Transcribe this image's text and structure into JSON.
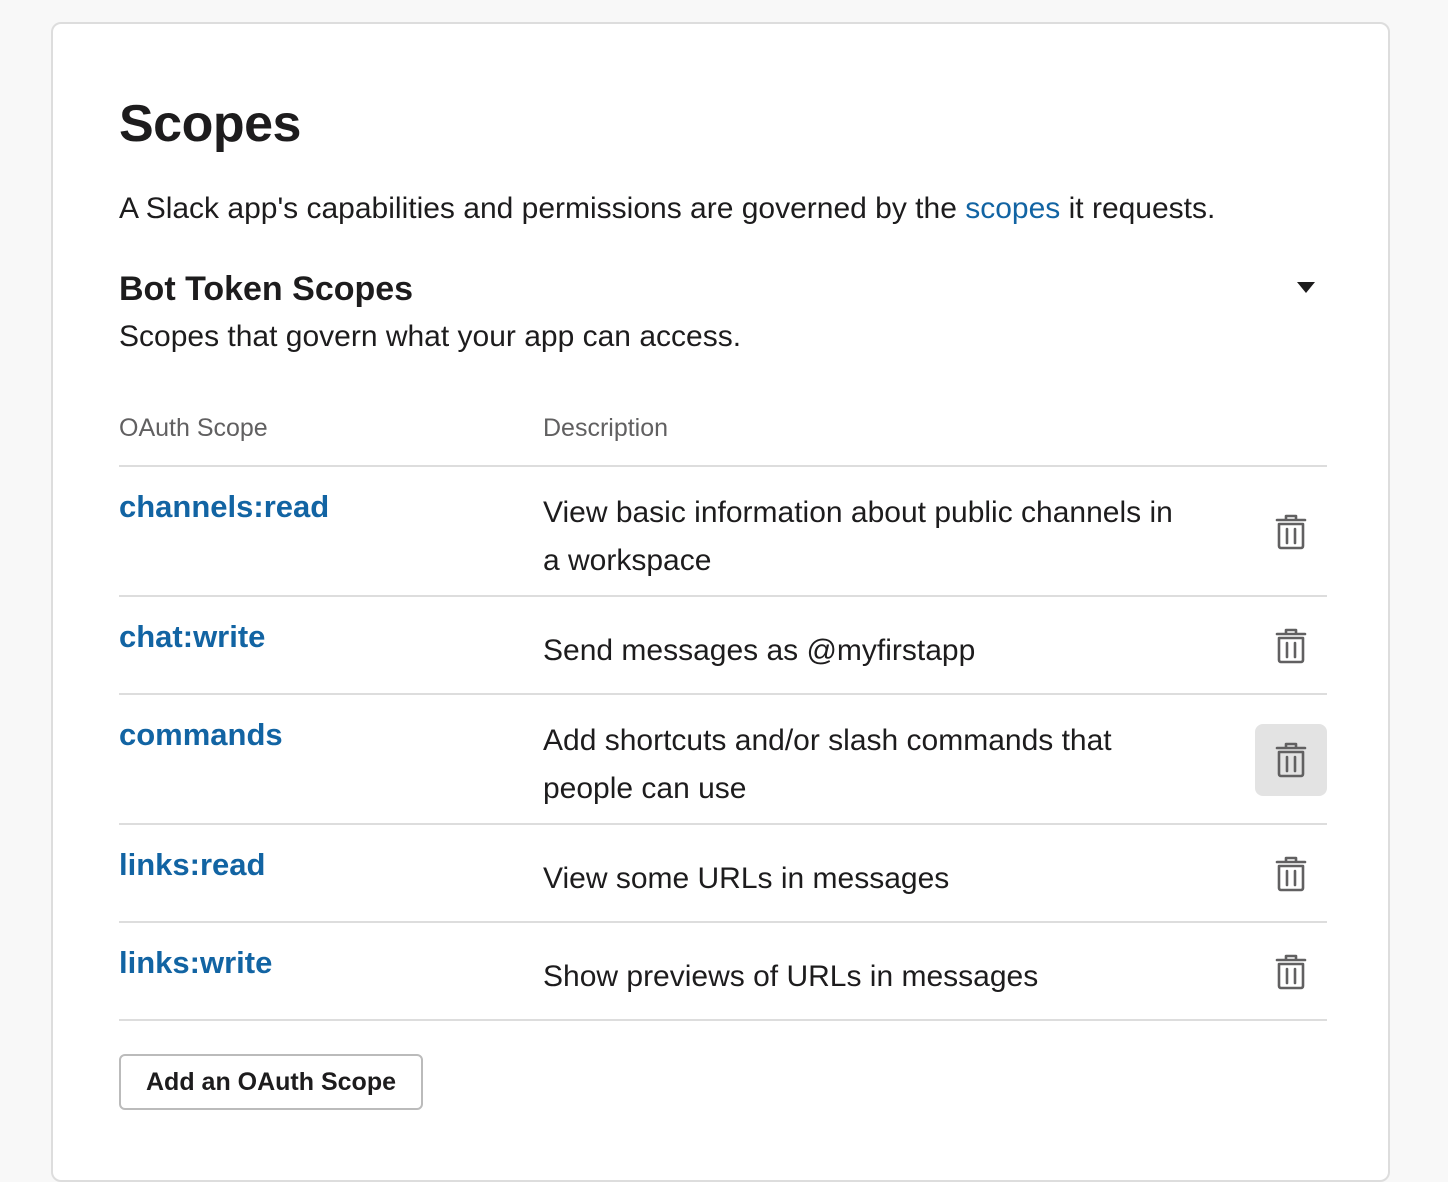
{
  "page": {
    "title": "Scopes",
    "intro_before": "A Slack app's capabilities and permissions are governed by the ",
    "intro_link": "scopes",
    "intro_after": " it requests."
  },
  "section": {
    "title": "Bot Token Scopes",
    "subtitle": "Scopes that govern what your app can access."
  },
  "table": {
    "headers": [
      "OAuth Scope",
      "Description"
    ],
    "rows": [
      {
        "scope": "channels:read",
        "description": "View basic information about public channels in a workspace"
      },
      {
        "scope": "chat:write",
        "description": "Send messages as @myfirstapp"
      },
      {
        "scope": "commands",
        "description": "Add shortcuts and/or slash commands that people can use"
      },
      {
        "scope": "links:read",
        "description": "View some URLs in messages"
      },
      {
        "scope": "links:write",
        "description": "Show previews of URLs in messages"
      }
    ]
  },
  "buttons": {
    "add_scope": "Add an OAuth Scope"
  },
  "icons": {
    "row_delete": "trash-icon",
    "collapse": "caret-down-icon"
  },
  "colors": {
    "link": "#1264a3",
    "text": "#1d1c1d",
    "muted": "#616061",
    "border": "#dddddd",
    "hover_bg": "#e3e3e3"
  }
}
